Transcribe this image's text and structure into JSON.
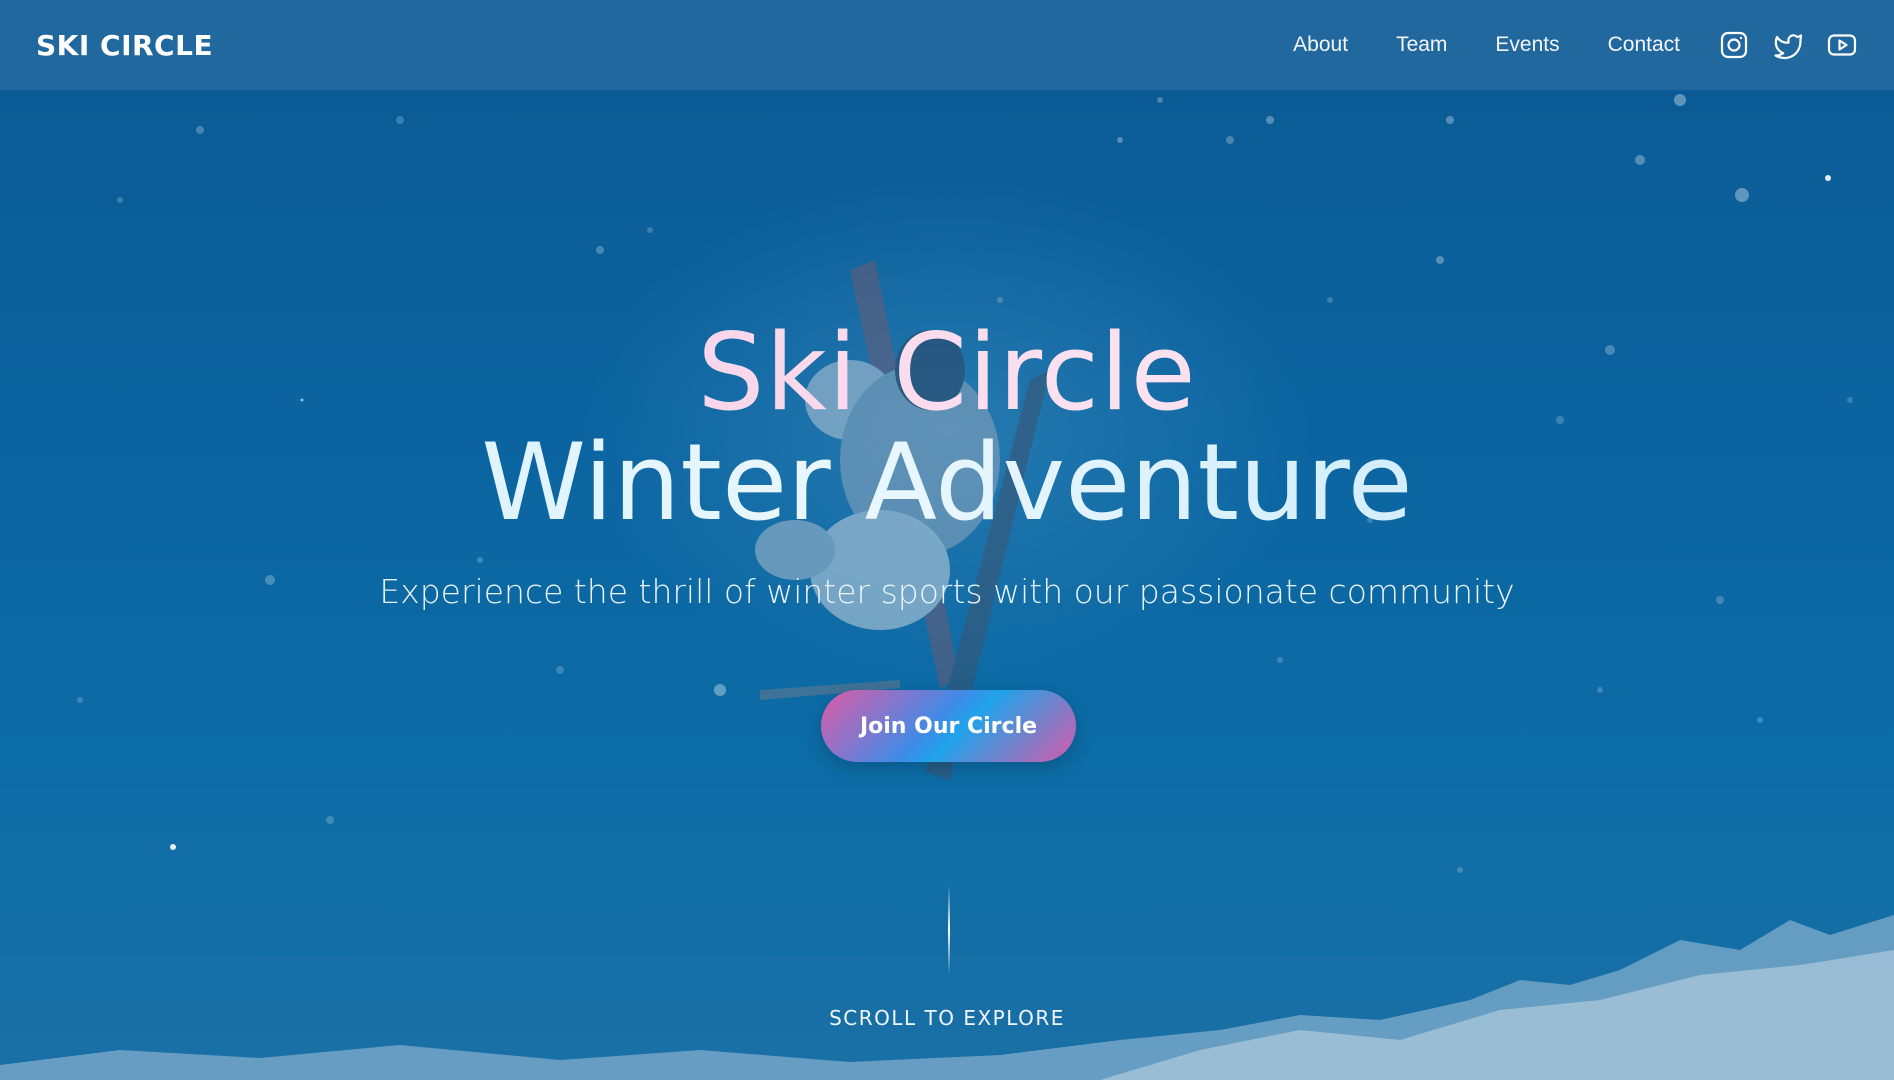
{
  "nav": {
    "brand": "SKI CIRCLE",
    "links": [
      {
        "label": "About"
      },
      {
        "label": "Team"
      },
      {
        "label": "Events"
      },
      {
        "label": "Contact"
      }
    ],
    "social_icons": [
      "instagram-icon",
      "twitter-icon",
      "youtube-icon"
    ]
  },
  "hero": {
    "title_line1": "Ski Circle",
    "title_line2": "Winter Adventure",
    "subtitle": "Experience the thrill of winter sports with our passionate community",
    "cta_label": "Join Our Circle",
    "scroll_hint": "SCROLL TO EXPLORE"
  },
  "colors": {
    "sky": "#0b64a0",
    "title_line1": "#f6d4ea",
    "title_line2": "#d8f1ff",
    "cta_pink": "#e05aa6",
    "cta_blue": "#1fa3ea"
  }
}
